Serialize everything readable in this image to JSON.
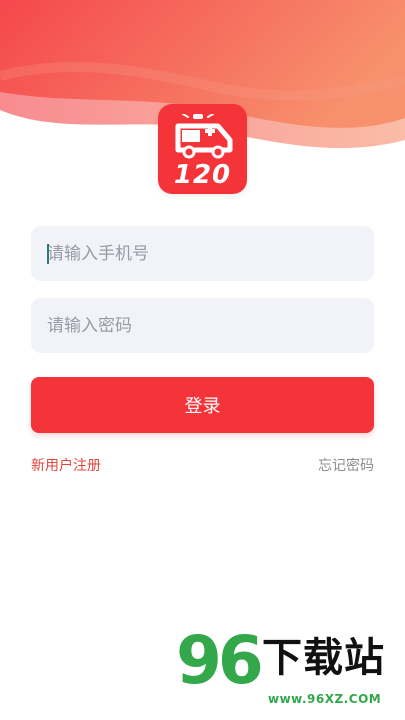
{
  "brand": {
    "logo_text": "120",
    "accent_color": "#f5343a",
    "header_gradient": [
      "#f54a4f",
      "#f6906c"
    ]
  },
  "form": {
    "phone_placeholder": "请输入手机号",
    "password_placeholder": "请输入密码",
    "login_label": "登录"
  },
  "links": {
    "register": "新用户注册",
    "forgot_password": "忘记密码"
  },
  "watermark": {
    "number": "96",
    "site_name": "下载站",
    "url": "www.96XZ.COM"
  },
  "icons": [
    "ambulance-icon"
  ]
}
